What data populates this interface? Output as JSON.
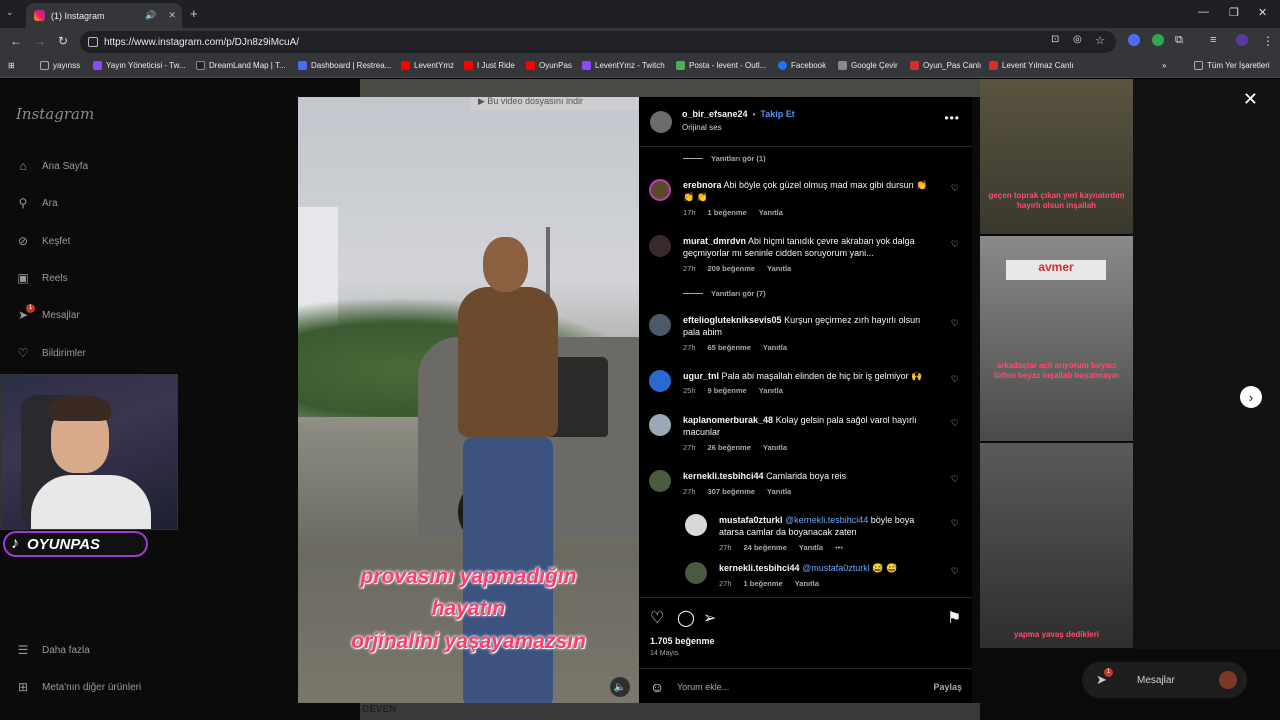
{
  "browser": {
    "tab_title": "(1) Instagram",
    "url": "https://www.instagram.com/p/DJn8z9iMcuA/",
    "bookmarks": [
      "yayınss",
      "Yayın Yöneticisi - Tw...",
      "DreamLand Map | T...",
      "Dashboard | Restrea...",
      "LeventYmz",
      "I Just Ride",
      "OyunPas",
      "LeventYmz - Twitch",
      "Posta - levent - Outl...",
      "Facebook",
      "Google Çevir",
      "Oyun_Pas Canlı",
      "Levent Yılmaz Canlı"
    ],
    "all_bookmarks": "Tüm Yer İşaretleri",
    "bookmark_colors": [
      "#777777",
      "#9146ff",
      "#222222",
      "#4a6cf7",
      "#ff0000",
      "#ff0000",
      "#ff0000",
      "#9146ff",
      "#4caf50",
      "#1877f2",
      "#888888",
      "#d32f2f",
      "#d32f2f"
    ]
  },
  "sidebar": {
    "logo": "Instagram",
    "items": [
      {
        "label": "Ana Sayfa",
        "icon": "home-icon"
      },
      {
        "label": "Ara",
        "icon": "search-icon"
      },
      {
        "label": "Keşfet",
        "icon": "compass-icon"
      },
      {
        "label": "Reels",
        "icon": "reels-icon"
      },
      {
        "label": "Mesajlar",
        "icon": "messenger-icon",
        "badge": "1"
      },
      {
        "label": "Bildirimler",
        "icon": "heart-icon"
      }
    ],
    "more": "Daha fazla",
    "meta": "Meta'nın diğer ürünleri"
  },
  "overlay": {
    "tiktok_name": "OYUNPAS"
  },
  "background_thumbs": {
    "t1": "geçen toprak çıkan yeri kaynatırdım hayırlı olsun inşallah",
    "t2": "arkadaşlar acil arıyorum boyacı lütfen beyaz inşallah boyatmayın",
    "t3": "yapma yavaş dedikleri",
    "t4_sign": "avmer",
    "t5": "DEVEN"
  },
  "video": {
    "caption_lines": [
      "provasını yapmadığın",
      "hayatın",
      "orjinalini yaşayamazsın"
    ],
    "toast": "Bu video dosyasını indir"
  },
  "post": {
    "username": "o_bir_efsane24",
    "follow": "Takip Et",
    "audio": "Orijinal ses",
    "view_replies_1": "Yanıtları gör (1)",
    "view_replies_2": "Yanıtları gör (7)",
    "comments": [
      {
        "user": "erebnora",
        "text": "Abi böyle çok güzel olmuş mad max gibi dursun 👏 👏 👏",
        "time": "17h",
        "likes": "1 beğenme",
        "reply": "Yanıtla"
      },
      {
        "user": "murat_dmrdvn",
        "text": "Abi hiçmi tanıdık çevre akraban yok dalga geçmiyorlar mı seninle cidden soruyorum yani...",
        "time": "27h",
        "likes": "209 beğenme",
        "reply": "Yanıtla"
      },
      {
        "user": "eftelioglutekniksevis05",
        "text": "Kurşun geçirmez zırh hayırlı olsun pala abim",
        "time": "27h",
        "likes": "65 beğenme",
        "reply": "Yanıtla"
      },
      {
        "user": "ugur_tnl",
        "text": "Pala abi maşallah elinden de hiç bir iş gelmiyor 🙌",
        "time": "25h",
        "likes": "9 beğenme",
        "reply": "Yanıtla"
      },
      {
        "user": "kaplanomerburak_48",
        "text": "Kolay gelsin pala sağol varol hayırlı macunlar",
        "time": "27h",
        "likes": "26 beğenme",
        "reply": "Yanıtla"
      },
      {
        "user": "kernekli.tesbihci44",
        "text": "Camlarida boya reis",
        "time": "27h",
        "likes": "307 beğenme",
        "reply": "Yanıtla"
      }
    ],
    "replies": [
      {
        "user": "mustafa0zturkl",
        "mention": "@kernekli.tesbihci44",
        "text": "böyle boya atarsa camlar da boyanacak zaten",
        "time": "27h",
        "likes": "24 beğenme",
        "reply": "Yanıtla"
      },
      {
        "user": "kernekli.tesbihci44",
        "mention": "@mustafa0zturkl",
        "text": "😅 😅",
        "time": "27h",
        "likes": "1 beğenme",
        "reply": "Yanıtla"
      }
    ],
    "like_count": "1.705 beğenme",
    "date": "14 Mayıs",
    "comment_placeholder": "Yorum ekle...",
    "share": "Paylaş"
  },
  "messages_pill": {
    "label": "Mesajlar",
    "badge": "1"
  }
}
